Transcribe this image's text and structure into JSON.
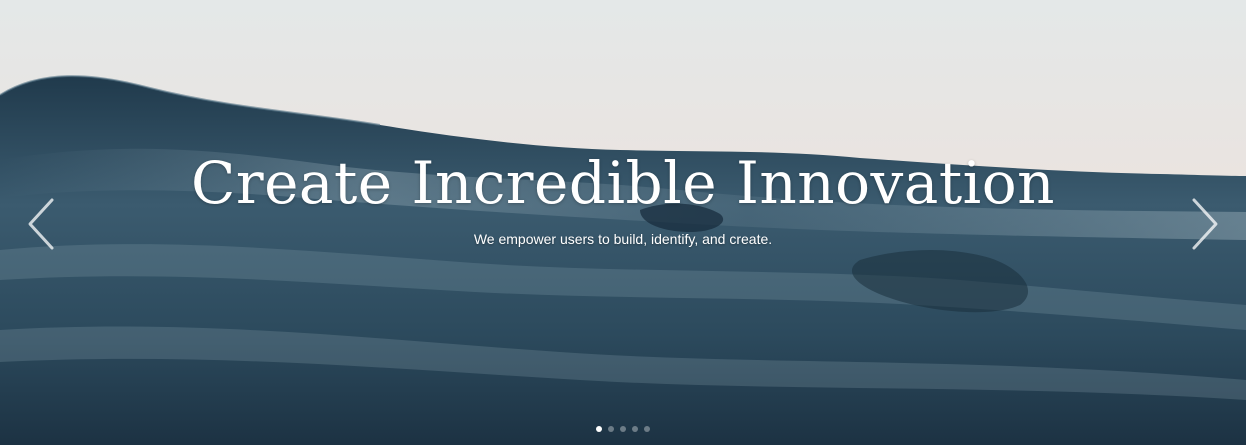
{
  "hero": {
    "title": "Create Incredible Innovation",
    "subtitle": "We empower users to build, identify, and create."
  },
  "carousel": {
    "prev_icon": "chevron-left-icon",
    "next_icon": "chevron-right-icon",
    "slide_count": 5,
    "active_slide": 1
  },
  "colors": {
    "sky_top": "#e6e9ea",
    "sky_horizon": "#eedcd6",
    "water_deep": "#1d3445",
    "water_mid": "#3a5a6e",
    "text": "#ffffff"
  }
}
